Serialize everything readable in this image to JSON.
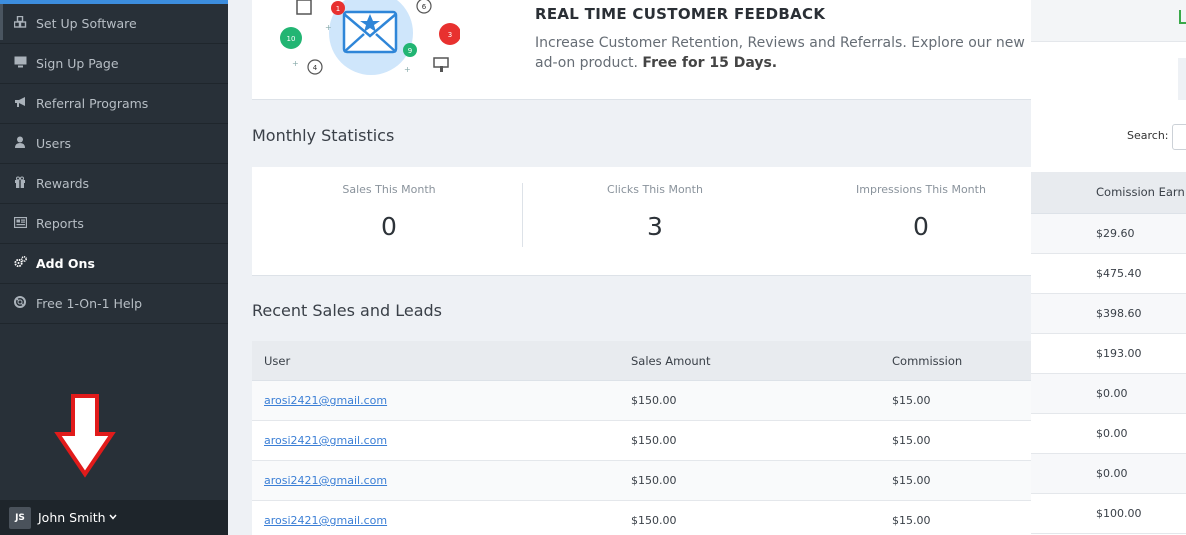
{
  "sidebar": {
    "items": [
      {
        "label": "Set Up Software",
        "icon": "cubes-icon"
      },
      {
        "label": "Sign Up Page",
        "icon": "monitor-icon"
      },
      {
        "label": "Referral Programs",
        "icon": "megaphone-icon"
      },
      {
        "label": "Users",
        "icon": "user-icon"
      },
      {
        "label": "Rewards",
        "icon": "gift-icon"
      },
      {
        "label": "Reports",
        "icon": "newspaper-icon"
      },
      {
        "label": "Add Ons",
        "icon": "cogs-icon",
        "active": true
      },
      {
        "label": "Free 1-On-1 Help",
        "icon": "lifebuoy-icon"
      }
    ],
    "user": {
      "initials": "JS",
      "name": "John Smith"
    }
  },
  "promo": {
    "title": "REAL TIME CUSTOMER FEEDBACK",
    "description": "Increase Customer Retention, Reviews and Referrals. Explore our new ad-on product.",
    "highlight": "Free for 15 Days.",
    "badges": [
      "1",
      "6",
      "10",
      "3",
      "9",
      "4"
    ]
  },
  "monthly": {
    "title": "Monthly Statistics",
    "stats": [
      {
        "label": "Sales This Month",
        "value": "0"
      },
      {
        "label": "Clicks This Month",
        "value": "3"
      },
      {
        "label": "Impressions This Month",
        "value": "0"
      }
    ]
  },
  "recent": {
    "title": "Recent Sales and Leads",
    "columns": [
      "User",
      "Sales Amount",
      "Commission"
    ],
    "rows": [
      {
        "user": "arosi2421@gmail.com",
        "sales": "$150.00",
        "commission": "$15.00"
      },
      {
        "user": "arosi2421@gmail.com",
        "sales": "$150.00",
        "commission": "$15.00"
      },
      {
        "user": "arosi2421@gmail.com",
        "sales": "$150.00",
        "commission": "$15.00"
      },
      {
        "user": "arosi2421@gmail.com",
        "sales": "$150.00",
        "commission": "$15.00"
      }
    ]
  },
  "right_panel": {
    "search_label": "Search:",
    "column": "Comission Earn",
    "values": [
      "$29.60",
      "$475.40",
      "$398.60",
      "$193.00",
      "$0.00",
      "$0.00",
      "$0.00",
      "$100.00"
    ]
  },
  "colors": {
    "sidebar_bg": "#283038",
    "accent": "#3c8dde",
    "link": "#3b7fd6",
    "arrow": "#e11b1b"
  }
}
